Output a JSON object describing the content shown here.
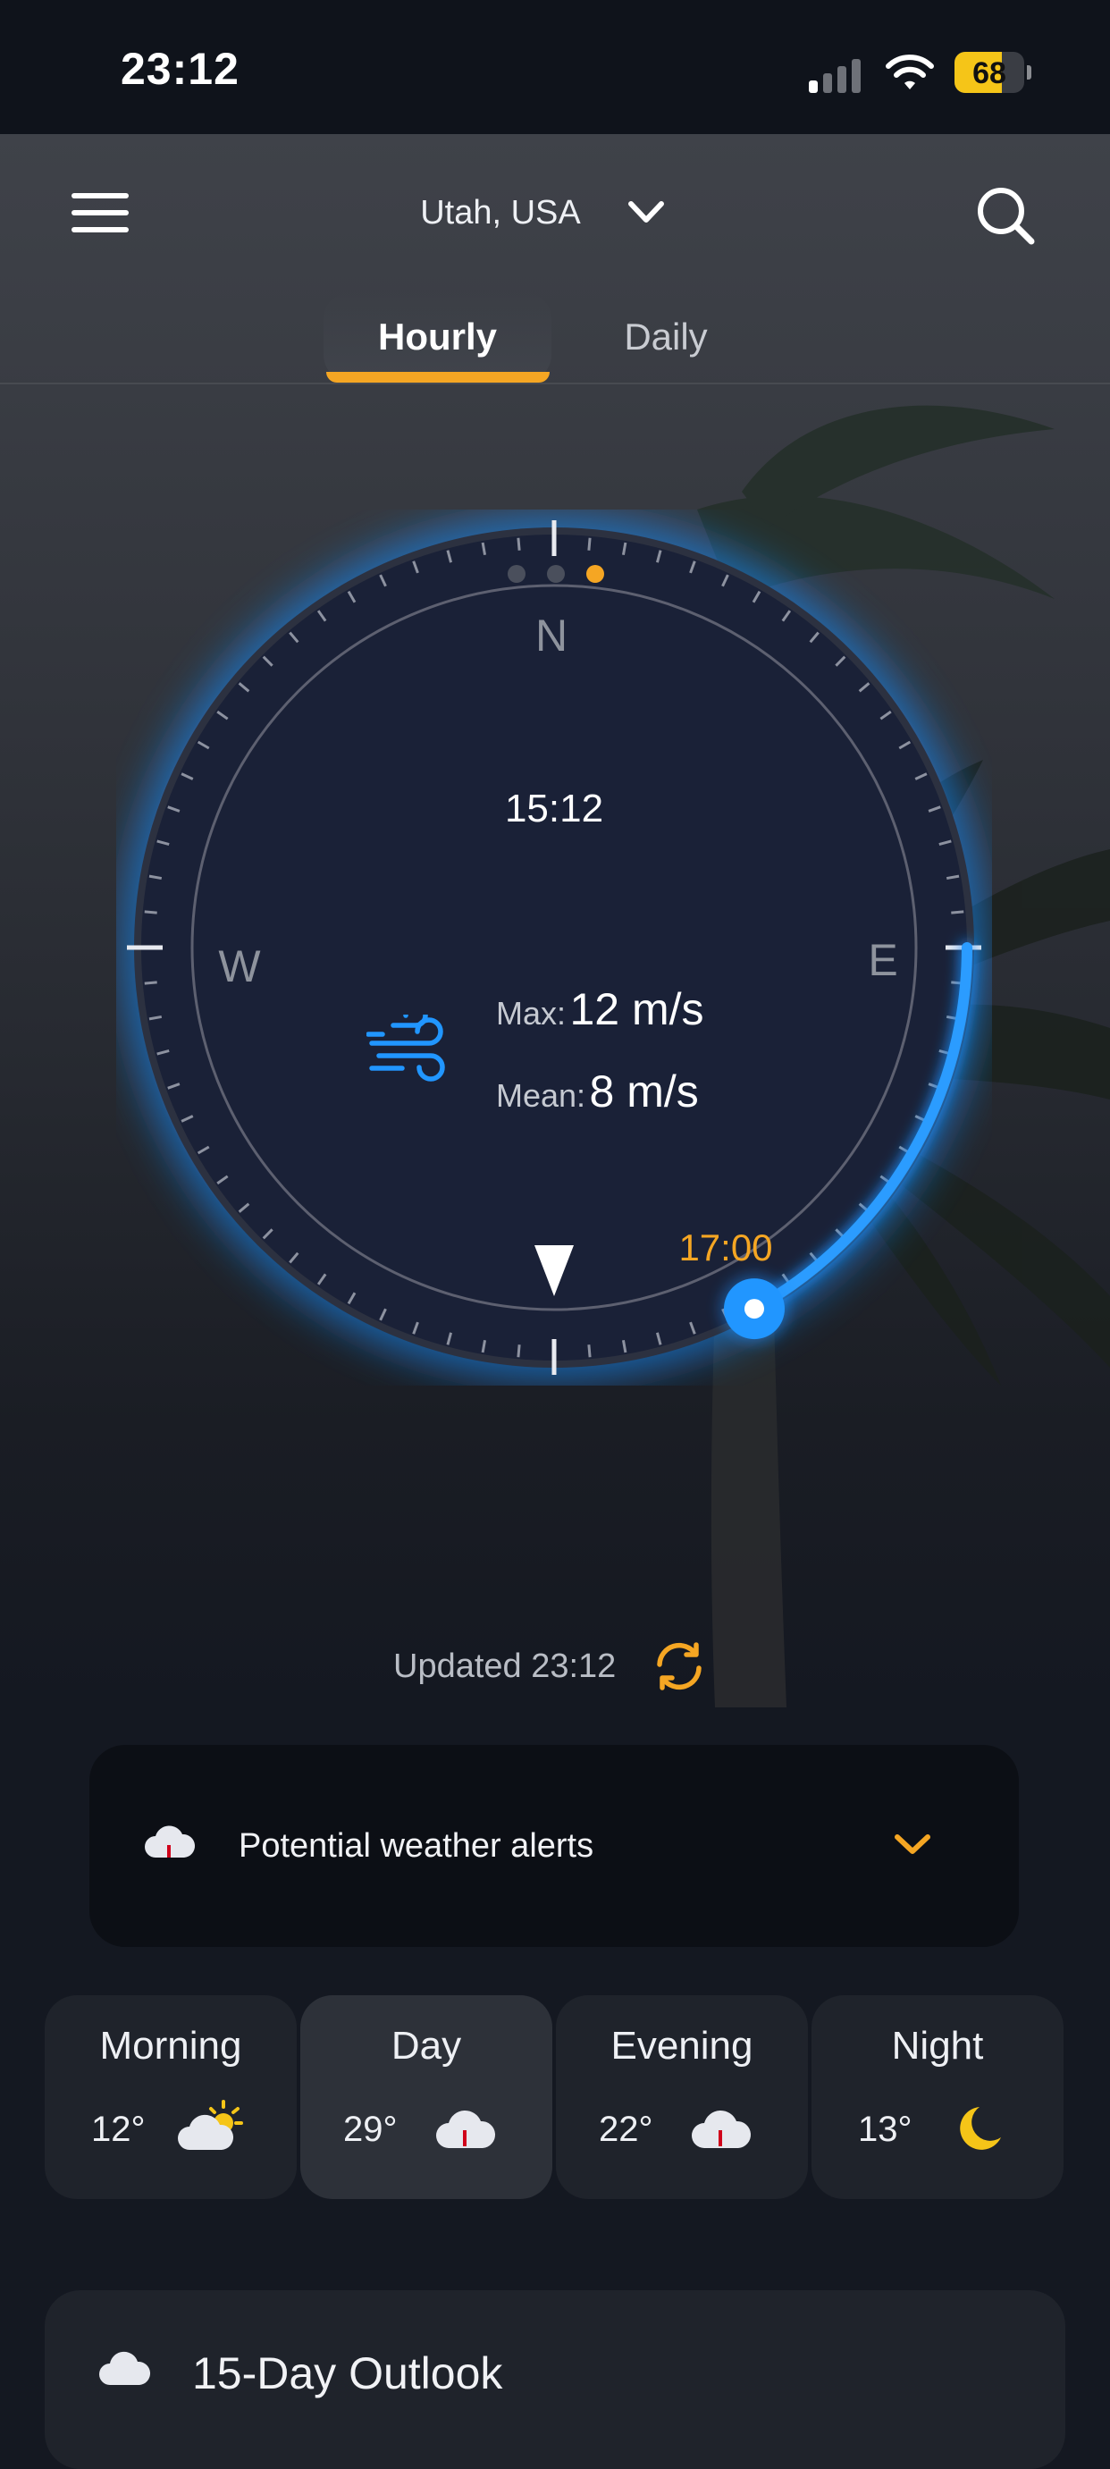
{
  "status_bar": {
    "time": "23:12",
    "battery": 68,
    "icons": [
      "signal-icon",
      "wifi-icon",
      "battery-icon"
    ]
  },
  "header": {
    "location": "Utah, USA",
    "icons": [
      "menu-icon",
      "chevron-down-icon",
      "search-icon"
    ]
  },
  "tabs": [
    {
      "label": "Hourly",
      "active": true
    },
    {
      "label": "Daily",
      "active": false
    }
  ],
  "compass": {
    "page_indicator": {
      "count": 3,
      "active": 3
    },
    "directions": {
      "n": "N",
      "w": "W",
      "e": "E"
    },
    "time": "15:12",
    "max_label": "Max:",
    "max_value": "12 m/s",
    "mean_label": "Mean:",
    "mean_value": "8 m/s",
    "marker_time": "17:00",
    "accent": "#1e90ff",
    "highlight": "#f5a623"
  },
  "updated": {
    "text": "Updated 23:12",
    "icon": "refresh-icon"
  },
  "alerts": {
    "label": "Potential weather alerts",
    "icon": "cloud-alert-icon"
  },
  "day_parts": [
    {
      "name": "Morning",
      "temp": "12°",
      "icon": "partly-sunny-icon",
      "active": false
    },
    {
      "name": "Day",
      "temp": "29°",
      "icon": "cloud-alert-icon",
      "active": true
    },
    {
      "name": "Evening",
      "temp": "22°",
      "icon": "cloud-alert-icon",
      "active": false
    },
    {
      "name": "Night",
      "temp": "13°",
      "icon": "moon-icon",
      "active": false
    }
  ],
  "outlook": {
    "label": "15-Day Outlook",
    "icon": "cloud-icon"
  }
}
